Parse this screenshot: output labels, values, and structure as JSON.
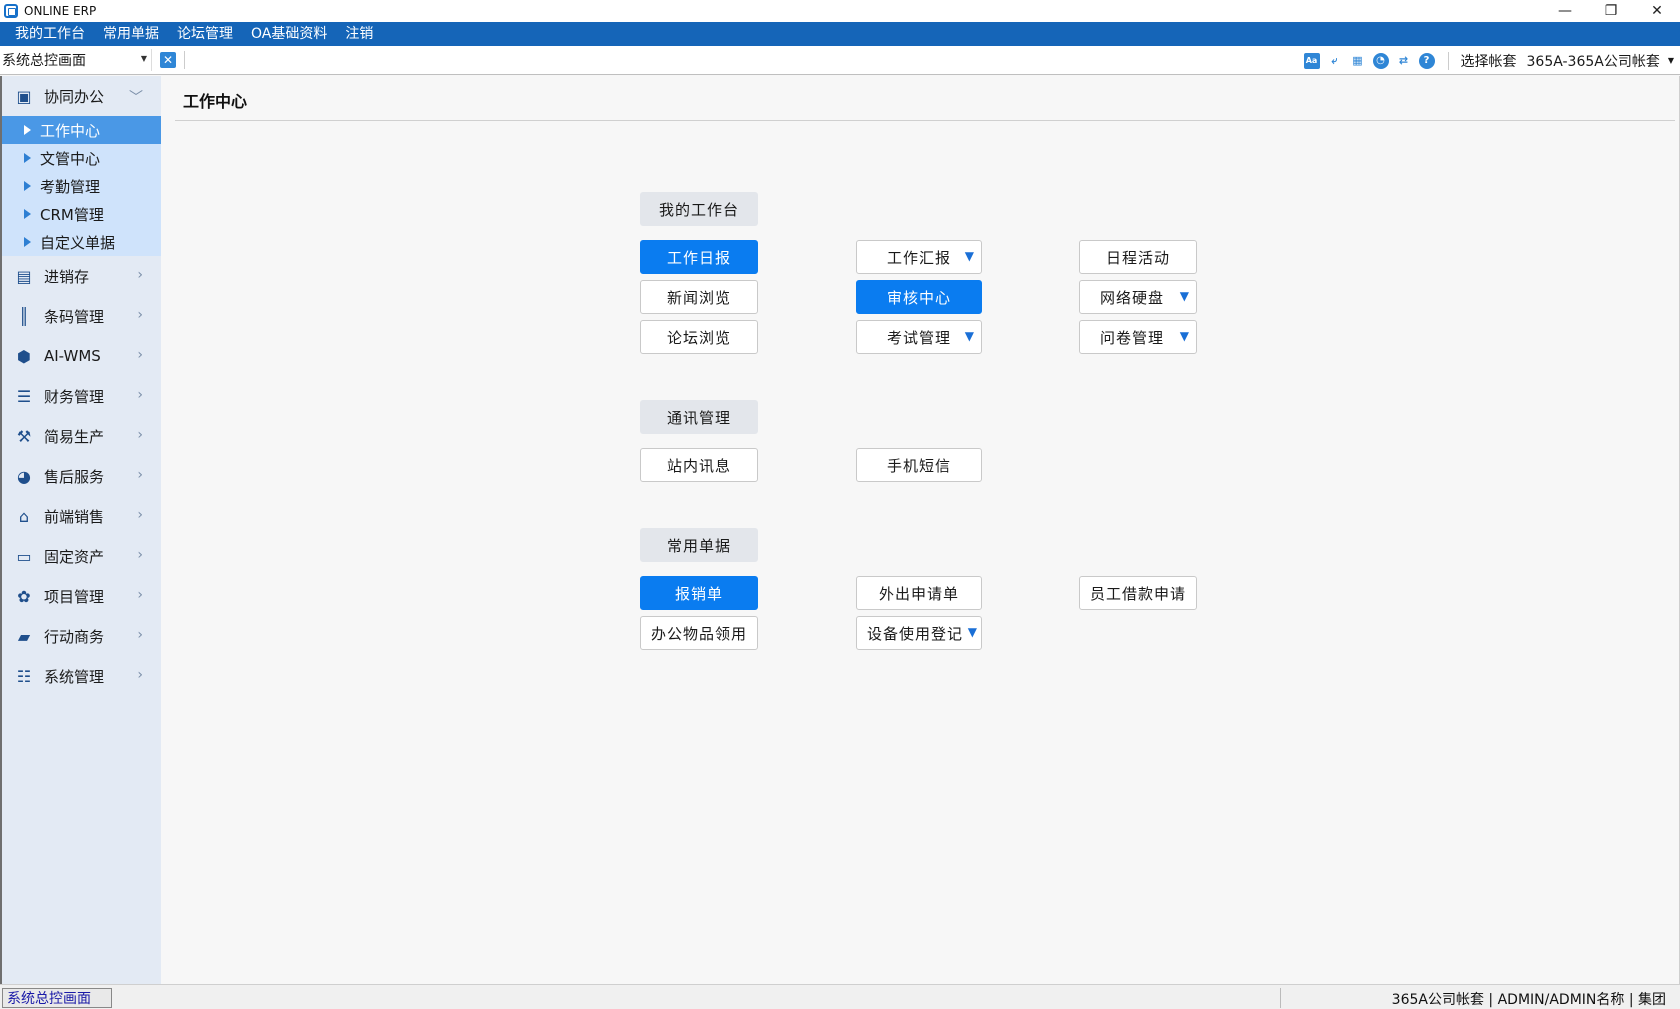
{
  "window": {
    "title": "ONLINE ERP",
    "minimize": "—",
    "restore": "❐",
    "close": "✕"
  },
  "menu": [
    "我的工作台",
    "常用单据",
    "论坛管理",
    "OA基础资料",
    "注销"
  ],
  "toolbar": {
    "page_select": "系统总控画面",
    "account_label": "选择帐套",
    "account_value": "365A-365A公司帐套"
  },
  "sidebar": {
    "expanded_group": {
      "label": "协同办公",
      "icon": "collab-icon",
      "subitems": [
        "工作中心",
        "文管中心",
        "考勤管理",
        "CRM管理",
        "自定义单据"
      ],
      "active_index": 0
    },
    "groups": [
      {
        "label": "进销存",
        "icon": "inventory-icon"
      },
      {
        "label": "条码管理",
        "icon": "barcode-icon"
      },
      {
        "label": "AI-WMS",
        "icon": "wms-icon"
      },
      {
        "label": "财务管理",
        "icon": "finance-icon"
      },
      {
        "label": "简易生产",
        "icon": "production-icon"
      },
      {
        "label": "售后服务",
        "icon": "aftersales-icon"
      },
      {
        "label": "前端销售",
        "icon": "store-icon"
      },
      {
        "label": "固定资产",
        "icon": "asset-icon"
      },
      {
        "label": "项目管理",
        "icon": "project-icon"
      },
      {
        "label": "行动商务",
        "icon": "briefcase-icon"
      },
      {
        "label": "系统管理",
        "icon": "settings-sliders-icon"
      }
    ]
  },
  "main": {
    "title": "工作中心",
    "sections": {
      "workbench": {
        "header": "我的工作台",
        "buttons": [
          "工作日报",
          "工作汇报",
          "日程活动",
          "新闻浏览",
          "审核中心",
          "网络硬盘",
          "论坛浏览",
          "考试管理",
          "问卷管理"
        ]
      },
      "comms": {
        "header": "通讯管理",
        "buttons": [
          "站内讯息",
          "手机短信"
        ]
      },
      "forms": {
        "header": "常用单据",
        "buttons": [
          "报销单",
          "外出申请单",
          "员工借款申请",
          "办公物品领用",
          "设备使用登记"
        ]
      }
    },
    "dropdown_marker": "▼"
  },
  "status": {
    "left": "系统总控画面",
    "right": "365A公司帐套 | ADMIN/ADMIN名称 | 集团"
  },
  "colors": {
    "menubar": "#1565b8",
    "primary_button": "#0a7cf0",
    "sidebar_bg": "#e3eaf4",
    "sidebar_active": "#4a98e6"
  }
}
